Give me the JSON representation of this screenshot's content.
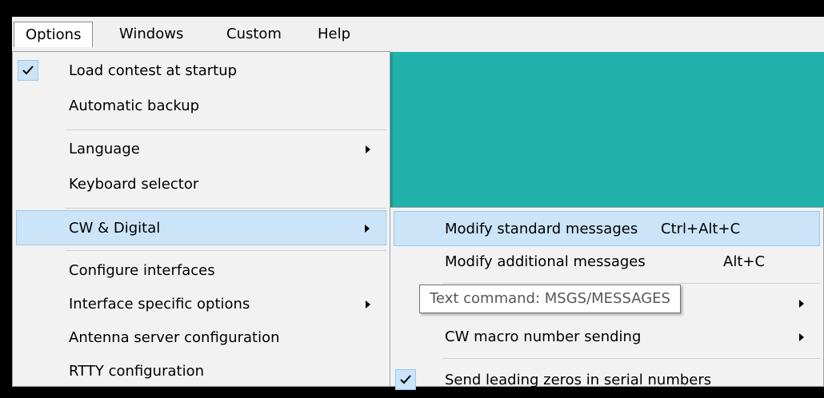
{
  "menubar": {
    "items": [
      {
        "label": "Options"
      },
      {
        "label": "Windows"
      },
      {
        "label": "Custom"
      },
      {
        "label": "Help"
      }
    ]
  },
  "options_menu": {
    "items": [
      {
        "label": "Load contest at startup",
        "checked": true
      },
      {
        "label": "Automatic backup"
      },
      {
        "label": "Language",
        "submenu": true
      },
      {
        "label": "Keyboard selector"
      },
      {
        "label": "CW & Digital",
        "submenu": true,
        "highlighted": true
      },
      {
        "label": "Configure interfaces"
      },
      {
        "label": "Interface specific options",
        "submenu": true
      },
      {
        "label": "Antenna server configuration"
      },
      {
        "label": "RTTY configuration"
      }
    ]
  },
  "cw_submenu": {
    "items": [
      {
        "label": "Modify standard messages",
        "shortcut": "Ctrl+Alt+C",
        "highlighted": true
      },
      {
        "label": "Modify additional messages",
        "shortcut": "Alt+C"
      },
      {
        "label": "",
        "submenu": true
      },
      {
        "label": "CW macro number sending",
        "submenu": true
      },
      {
        "label": "Send leading zeros in serial numbers",
        "checked": true
      }
    ]
  },
  "tooltip": {
    "text": "Text command: MSGS/MESSAGES"
  },
  "colors": {
    "background": "#000000",
    "teal": "#20b2aa",
    "menu_bg": "#f2f2f2",
    "highlight": "#cce4f7"
  }
}
